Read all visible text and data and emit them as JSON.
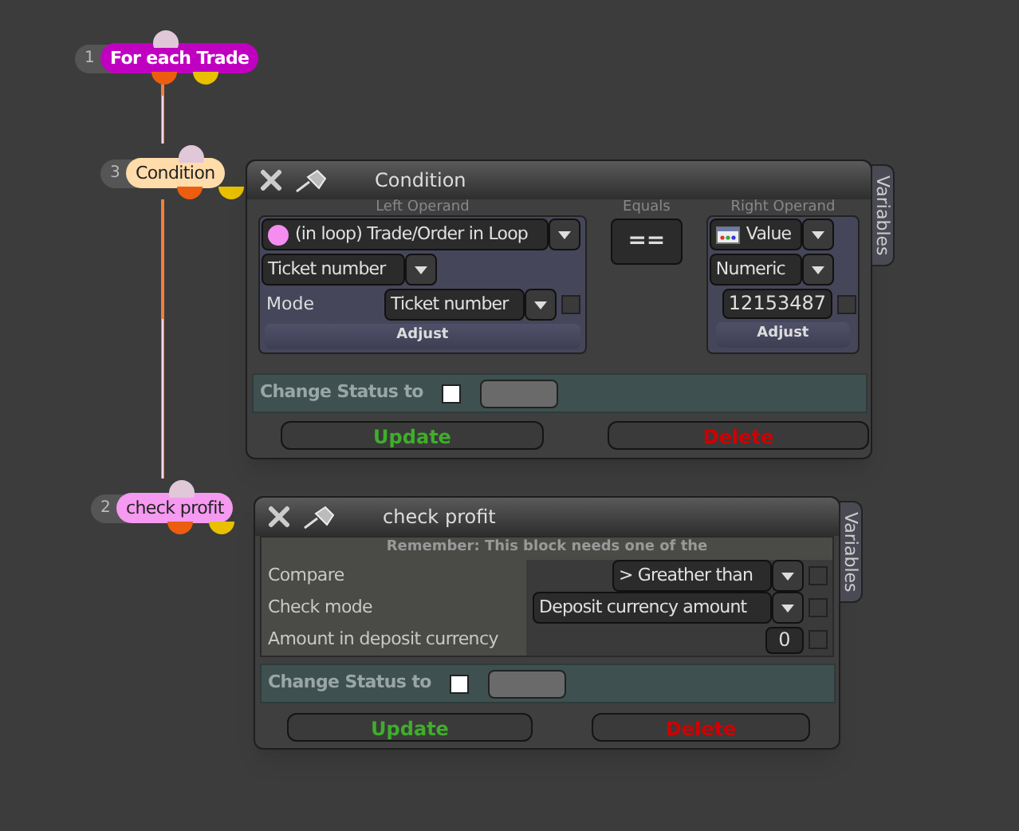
{
  "nodes": [
    {
      "number": "1",
      "label": "For each Trade",
      "color": "#c000c0",
      "bold": true
    },
    {
      "number": "3",
      "label": "Condition",
      "color": "#ffdcaa",
      "bold": false
    },
    {
      "number": "2",
      "label": "check profit",
      "color": "#f59af0",
      "bold": false
    }
  ],
  "condition_panel": {
    "title": "Condition",
    "variables_tab": "Variables",
    "left_operand": {
      "label": "Left Operand",
      "source": "(in loop) Trade/Order in Loop",
      "property": "Ticket number",
      "mode_label": "Mode",
      "mode": "Ticket number",
      "mode_checked": false,
      "adjust": "Adjust"
    },
    "equals": {
      "label": "Equals",
      "operator": "=="
    },
    "right_operand": {
      "label": "Right Operand",
      "type": "Value",
      "format": "Numeric",
      "value": "12153487",
      "checked": false,
      "adjust": "Adjust"
    },
    "status": {
      "label": "Change Status to",
      "checked": false
    },
    "update": "Update",
    "delete": "Delete"
  },
  "check_profit_panel": {
    "title": "check profit",
    "variables_tab": "Variables",
    "notice": "Remember: This block needs one of the",
    "rows": [
      {
        "label": "Compare",
        "kind": "dropdown",
        "value": "> Greather than",
        "checked": false
      },
      {
        "label": "Check mode",
        "kind": "dropdown",
        "value": "Deposit currency amount",
        "checked": false
      },
      {
        "label": "Amount in deposit currency",
        "kind": "number",
        "value": "0",
        "checked": false
      }
    ],
    "status": {
      "label": "Change Status to",
      "checked": false
    },
    "update": "Update",
    "delete": "Delete"
  }
}
